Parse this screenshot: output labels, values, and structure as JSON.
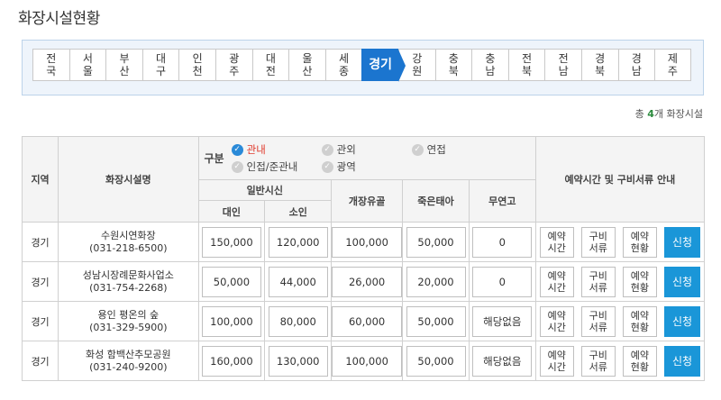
{
  "page_title": "화장시설현황",
  "regions": [
    {
      "line1": "전",
      "line2": "국"
    },
    {
      "line1": "서",
      "line2": "울"
    },
    {
      "line1": "부",
      "line2": "산"
    },
    {
      "line1": "대",
      "line2": "구"
    },
    {
      "line1": "인",
      "line2": "천"
    },
    {
      "line1": "광",
      "line2": "주"
    },
    {
      "line1": "대",
      "line2": "전"
    },
    {
      "line1": "울",
      "line2": "산"
    },
    {
      "line1": "세",
      "line2": "종"
    },
    {
      "line1": "경기",
      "line2": ""
    },
    {
      "line1": "강",
      "line2": "원"
    },
    {
      "line1": "충",
      "line2": "북"
    },
    {
      "line1": "충",
      "line2": "남"
    },
    {
      "line1": "전",
      "line2": "북"
    },
    {
      "line1": "전",
      "line2": "남"
    },
    {
      "line1": "경",
      "line2": "북"
    },
    {
      "line1": "경",
      "line2": "남"
    },
    {
      "line1": "제",
      "line2": "주"
    }
  ],
  "active_region": "경기",
  "count": {
    "prefix": "총",
    "number": "4",
    "suffix": "개 화장시설"
  },
  "table": {
    "col_region": "지역",
    "col_name": "화장시설명",
    "legend_title": "구분",
    "legend": {
      "internal": "관내",
      "external": "관외",
      "linked": "연접",
      "linked_internal": "인접/준관내",
      "wide": "광역"
    },
    "col_general": "일반시신",
    "col_adult": "대인",
    "col_child": "소인",
    "col_remains": "개장유골",
    "col_fetus": "죽은태아",
    "col_unclaimed": "무연고",
    "col_guide": "예약시간 및 구비서류 안내"
  },
  "actions": {
    "reserve_time": [
      "예약",
      "시간"
    ],
    "documents": [
      "구비",
      "서류"
    ],
    "reserve_status": [
      "예약",
      "현황"
    ],
    "apply": "신청"
  },
  "rows": [
    {
      "region": "경기",
      "name": "수원시연화장",
      "phone": "(031-218-6500)",
      "adult": "150,000",
      "child": "120,000",
      "remains": "100,000",
      "fetus": "50,000",
      "unclaimed": "0"
    },
    {
      "region": "경기",
      "name": "성남시장례문화사업소",
      "phone": "(031-754-2268)",
      "adult": "50,000",
      "child": "44,000",
      "remains": "26,000",
      "fetus": "20,000",
      "unclaimed": "0"
    },
    {
      "region": "경기",
      "name": "용인 평온의 숲",
      "phone": "(031-329-5900)",
      "adult": "100,000",
      "child": "80,000",
      "remains": "60,000",
      "fetus": "50,000",
      "unclaimed": "해당없음"
    },
    {
      "region": "경기",
      "name": "화성 함백산추모공원",
      "phone": "(031-240-9200)",
      "adult": "160,000",
      "child": "130,000",
      "remains": "100,000",
      "fetus": "50,000",
      "unclaimed": "해당없음"
    }
  ],
  "colors": {
    "accent": "#1b75cf",
    "apply": "#1a96d8",
    "legend_active": "#e0392b",
    "count": "#2a8a3c"
  }
}
